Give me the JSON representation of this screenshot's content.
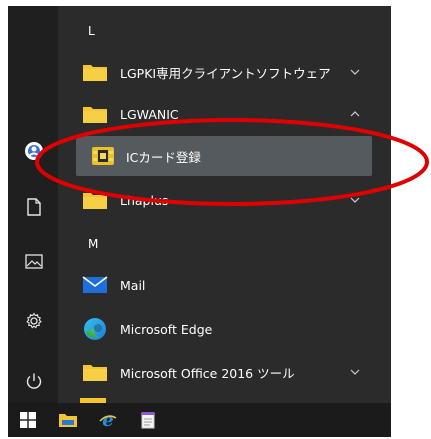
{
  "sections": {
    "l_letter": "L",
    "m_letter": "M"
  },
  "apps": {
    "lgpki": {
      "label": "LGPKI専用クライアントソフトウェア",
      "icon": "folder-icon",
      "expanded": false
    },
    "lgwanic": {
      "label": "LGWANIC",
      "icon": "folder-icon",
      "expanded": true
    },
    "ic_card": {
      "label": "ICカード登録",
      "icon": "ic-card-icon",
      "highlighted": true
    },
    "lhaplus": {
      "label": "Lhaplus",
      "icon": "folder-icon",
      "expanded": false
    },
    "mail": {
      "label": "Mail",
      "icon": "mail-icon"
    },
    "edge": {
      "label": "Microsoft Edge",
      "icon": "edge-icon"
    },
    "office": {
      "label": "Microsoft Office 2016 ツール",
      "icon": "folder-icon",
      "expanded": false
    }
  },
  "rail": {
    "items": [
      {
        "icon": "user-avatar-icon"
      },
      {
        "icon": "document-icon"
      },
      {
        "icon": "pictures-icon"
      },
      {
        "icon": "settings-gear-icon"
      },
      {
        "icon": "power-icon"
      }
    ]
  },
  "taskbar": {
    "items": [
      {
        "icon": "windows-start-icon"
      },
      {
        "icon": "file-explorer-icon"
      },
      {
        "icon": "internet-explorer-icon"
      },
      {
        "icon": "notepad-icon"
      }
    ]
  },
  "annotation": {
    "color": "#e00000",
    "shape": "ellipse"
  },
  "colors": {
    "menu_bg": "#2b2b2b",
    "rail_bg": "#1f1f1f",
    "highlight_bg": "#555a5e",
    "folder": "#f4c531",
    "taskbar_bg": "#1b1b1b"
  }
}
